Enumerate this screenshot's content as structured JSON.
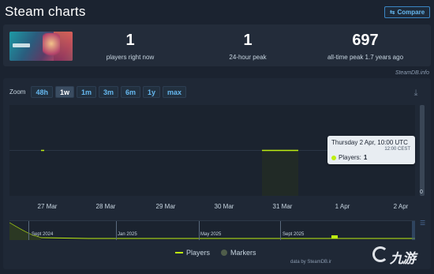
{
  "page": {
    "title": "Steam charts",
    "compare_label": "Compare",
    "compare_icon": "compare-arrows-icon"
  },
  "stats": {
    "players_now": {
      "value": "1",
      "label": "players right now"
    },
    "peak_24h": {
      "value": "1",
      "label": "24-hour peak"
    },
    "all_time_peak": {
      "value": "697",
      "label": "all-time peak 1.7 years ago"
    },
    "attribution": "SteamDB.info"
  },
  "chart": {
    "zoom_label": "Zoom",
    "zoom_options": [
      "48h",
      "1w",
      "1m",
      "3m",
      "6m",
      "1y",
      "max"
    ],
    "active_zoom": "1w",
    "download_icon": "download-icon",
    "y_ticks": [
      "0"
    ],
    "x_ticks": [
      "27 Mar",
      "28 Mar",
      "29 Mar",
      "30 Mar",
      "31 Mar",
      "1 Apr",
      "2 Apr"
    ],
    "tooltip": {
      "title": "Thursday 2 Apr, 10:00 UTC",
      "subtitle": "12:00 CEST",
      "series_label": "Players:",
      "series_value": "1"
    },
    "navigator_labels": [
      "Sept 2024",
      "Jan 2025",
      "May 2025",
      "Sept 2025"
    ],
    "legend": {
      "players": "Players",
      "markers": "Markers"
    },
    "attribution": "data by SteamDB.ir",
    "colors": {
      "players": "#beee11",
      "accent": "#66b8f0",
      "background": "#1b2330"
    }
  },
  "chart_data": {
    "type": "line",
    "series": [
      {
        "name": "Players",
        "x": [
          "27 Mar",
          "31 Mar",
          "31 Mar",
          "2 Apr"
        ],
        "values": [
          1,
          1,
          1,
          1
        ]
      }
    ],
    "xlabel": "",
    "ylabel": "",
    "ylim": [
      0,
      2
    ],
    "grid": true
  },
  "watermark": {
    "logo_text": "九游"
  }
}
